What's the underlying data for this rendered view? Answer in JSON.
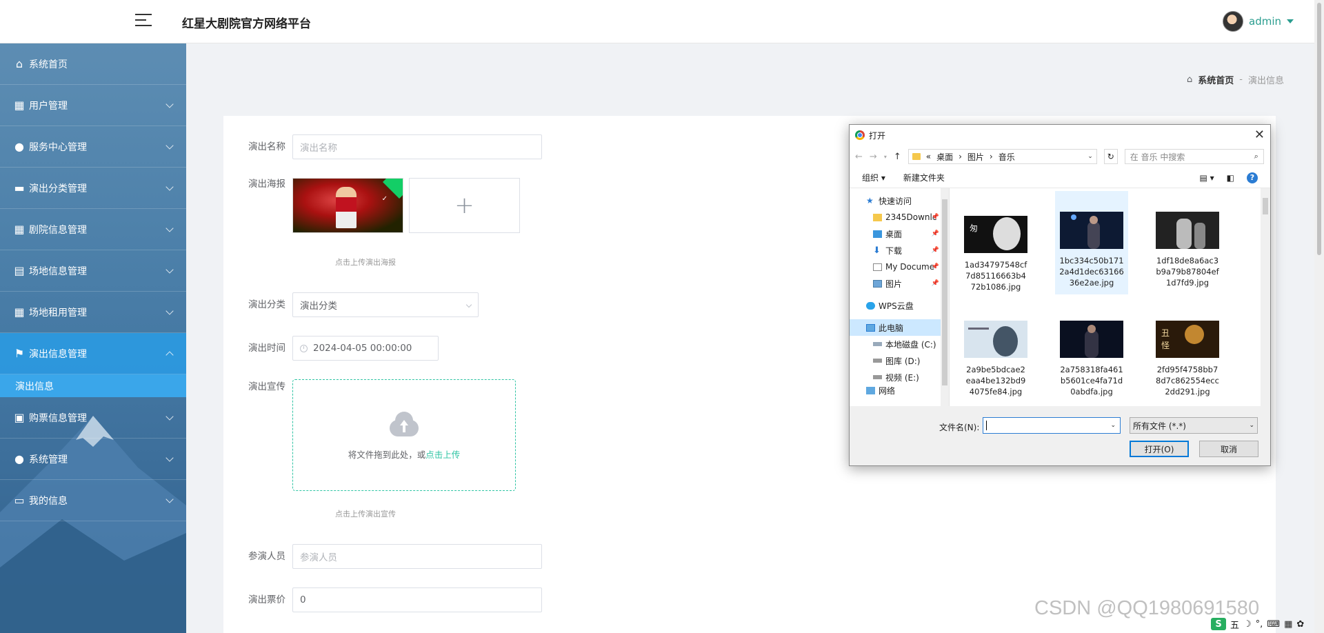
{
  "header": {
    "title": "红星大剧院官方网络平台",
    "user_name": "admin"
  },
  "sidebar": {
    "items": [
      {
        "label": "系统首页",
        "icon": "home-icon"
      },
      {
        "label": "用户管理",
        "icon": "grid-icon"
      },
      {
        "label": "服务中心管理",
        "icon": "bulb-icon"
      },
      {
        "label": "演出分类管理",
        "icon": "monitor-icon"
      },
      {
        "label": "剧院信息管理",
        "icon": "grid-icon"
      },
      {
        "label": "场地信息管理",
        "icon": "clipboard-icon"
      },
      {
        "label": "场地租用管理",
        "icon": "table-icon"
      },
      {
        "label": "演出信息管理",
        "icon": "flag-icon"
      },
      {
        "label": "购票信息管理",
        "icon": "wallet-icon"
      },
      {
        "label": "系统管理",
        "icon": "user-icon"
      },
      {
        "label": "我的信息",
        "icon": "card-icon"
      }
    ],
    "active_sub": "演出信息"
  },
  "breadcrumb": {
    "home": "系统首页",
    "separator": "-",
    "current": "演出信息"
  },
  "form": {
    "name_label": "演出名称",
    "name_placeholder": "演出名称",
    "poster_label": "演出海报",
    "poster_tip": "点击上传演出海报",
    "category_label": "演出分类",
    "category_placeholder": "演出分类",
    "time_label": "演出时间",
    "time_value": "2024-04-05 00:00:00",
    "promo_label": "演出宣传",
    "promo_drop_text": "将文件拖到此处，或",
    "promo_click_text": "点击上传",
    "promo_tip": "点击上传演出宣传",
    "cast_label": "参演人员",
    "cast_placeholder": "参演人员",
    "price_label": "演出票价",
    "price_value": "0"
  },
  "dialog": {
    "title": "打开",
    "path": [
      "«",
      "桌面",
      "›",
      "图片",
      "›",
      "音乐"
    ],
    "search_placeholder": "在 音乐 中搜索",
    "organize": "组织 ▾",
    "new_folder": "新建文件夹",
    "tree": [
      {
        "label": "快速访问",
        "level": 1,
        "icon": "star-icon"
      },
      {
        "label": "2345Downlc",
        "level": 2,
        "icon": "folder-icon",
        "pinned": true
      },
      {
        "label": "桌面",
        "level": 2,
        "icon": "desktop-icon",
        "pinned": true
      },
      {
        "label": "下载",
        "level": 2,
        "icon": "download-icon",
        "pinned": true
      },
      {
        "label": "My Docume",
        "level": 2,
        "icon": "document-icon",
        "pinned": true
      },
      {
        "label": "图片",
        "level": 2,
        "icon": "pictures-icon",
        "pinned": true
      },
      {
        "label": "WPS云盘",
        "level": 1,
        "icon": "cloud-icon"
      },
      {
        "label": "此电脑",
        "level": 1,
        "icon": "computer-icon",
        "selected": true
      },
      {
        "label": "本地磁盘 (C:)",
        "level": 2,
        "icon": "drive-icon"
      },
      {
        "label": "图库 (D:)",
        "level": 2,
        "icon": "drive-icon"
      },
      {
        "label": "视频 (E:)",
        "level": 2,
        "icon": "drive-icon"
      },
      {
        "label": "网络",
        "level": 1,
        "icon": "network-icon"
      }
    ],
    "files": [
      {
        "name": "1ad34797548cf7d85116663b472b1086.jpg",
        "lines": [
          "1ad34797548cf",
          "7d85116663b4",
          "72b1086.jpg"
        ]
      },
      {
        "name": "1bc334c50b1712a4d1d0c6316636e2ae.jpg",
        "lines": [
          "1bc334c50b171",
          "2a4d1dec63166",
          "36e2ae.jpg"
        ]
      },
      {
        "name": "1df18de8a6ac3b9a79b87804ef1d7fd9.jpg",
        "lines": [
          "1df18de8a6ac3",
          "b9a79b87804ef",
          "1d7fd9.jpg"
        ]
      },
      {
        "name": "2a9be5bdcae2eaa4be132bd94075fe84.jpg",
        "lines": [
          "2a9be5bdcae2",
          "eaa4be132bd9",
          "4075fe84.jpg"
        ]
      },
      {
        "name": "2a758318fa461b5601ce4fa71d0abdfa.jpg",
        "lines": [
          "2a758318fa461",
          "b5601ce4fa71d",
          "0abdfa.jpg"
        ]
      },
      {
        "name": "2fd95f4758bb78d7c862554ecc2dd291.jpg",
        "lines": [
          "2fd95f4758bb7",
          "8d7c862554ecc",
          "2dd291.jpg"
        ]
      }
    ],
    "filename_label": "文件名(N):",
    "filetype_value": "所有文件 (*.*)",
    "open_button": "打开(O)",
    "cancel_button": "取消"
  },
  "watermark": "CSDN @QQ1980691580",
  "tray": [
    "五",
    "☽",
    "°,",
    "⌨",
    "▦",
    "✿"
  ]
}
